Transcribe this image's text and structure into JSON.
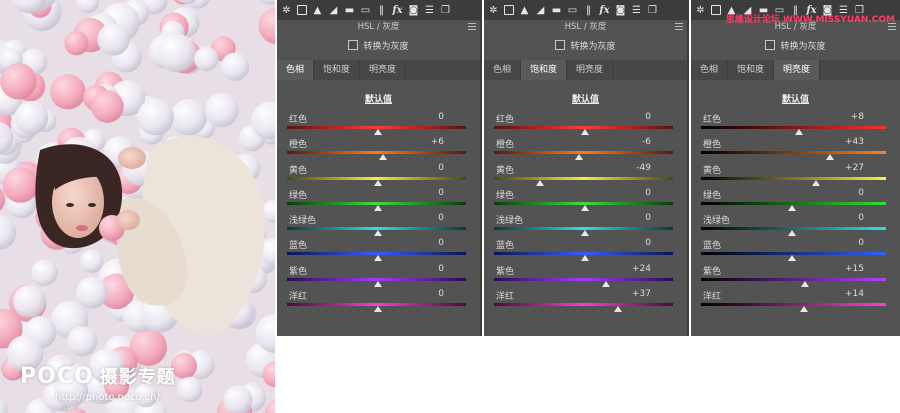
{
  "watermark": {
    "brand": "POCO",
    "brand_cn": "摄影专题",
    "url": "http://photo.poco.cn/"
  },
  "site_watermark": "思缘设计论坛 WWW.MISSYUAN.COM",
  "panels": [
    {
      "title": "HSL / 灰度",
      "grayscale_label": "转换为灰度",
      "tabs": [
        "色相",
        "饱和度",
        "明亮度"
      ],
      "active_tab": 0,
      "default_label": "默认值",
      "rows": [
        {
          "label": "红色",
          "value": "0",
          "level": 0.5
        },
        {
          "label": "橙色",
          "value": "+6",
          "level": 0.53
        },
        {
          "label": "黄色",
          "value": "0",
          "level": 0.5
        },
        {
          "label": "绿色",
          "value": "0",
          "level": 0.5
        },
        {
          "label": "浅绿色",
          "value": "0",
          "level": 0.5
        },
        {
          "label": "蓝色",
          "value": "0",
          "level": 0.5
        },
        {
          "label": "紫色",
          "value": "0",
          "level": 0.5
        },
        {
          "label": "洋红",
          "value": "0",
          "level": 0.5
        }
      ]
    },
    {
      "title": "HSL / 灰度",
      "grayscale_label": "转换为灰度",
      "tabs": [
        "色相",
        "饱和度",
        "明亮度"
      ],
      "active_tab": 1,
      "default_label": "默认值",
      "rows": [
        {
          "label": "红色",
          "value": "0",
          "level": 0.5
        },
        {
          "label": "橙色",
          "value": "-6",
          "level": 0.47
        },
        {
          "label": "黄色",
          "value": "-49",
          "level": 0.255
        },
        {
          "label": "绿色",
          "value": "0",
          "level": 0.5
        },
        {
          "label": "浅绿色",
          "value": "0",
          "level": 0.5
        },
        {
          "label": "蓝色",
          "value": "0",
          "level": 0.5
        },
        {
          "label": "紫色",
          "value": "+24",
          "level": 0.62
        },
        {
          "label": "洋红",
          "value": "+37",
          "level": 0.685
        }
      ]
    },
    {
      "title": "HSL / 灰度",
      "grayscale_label": "转换为灰度",
      "tabs": [
        "色相",
        "饱和度",
        "明亮度"
      ],
      "active_tab": 2,
      "default_label": "默认值",
      "rows": [
        {
          "label": "红色",
          "value": "+8",
          "level": 0.54
        },
        {
          "label": "橙色",
          "value": "+43",
          "level": 0.715
        },
        {
          "label": "黄色",
          "value": "+27",
          "level": 0.635
        },
        {
          "label": "绿色",
          "value": "0",
          "level": 0.5
        },
        {
          "label": "浅绿色",
          "value": "0",
          "level": 0.5
        },
        {
          "label": "蓝色",
          "value": "0",
          "level": 0.5
        },
        {
          "label": "紫色",
          "value": "+15",
          "level": 0.575
        },
        {
          "label": "洋红",
          "value": "+14",
          "level": 0.57
        }
      ]
    }
  ]
}
